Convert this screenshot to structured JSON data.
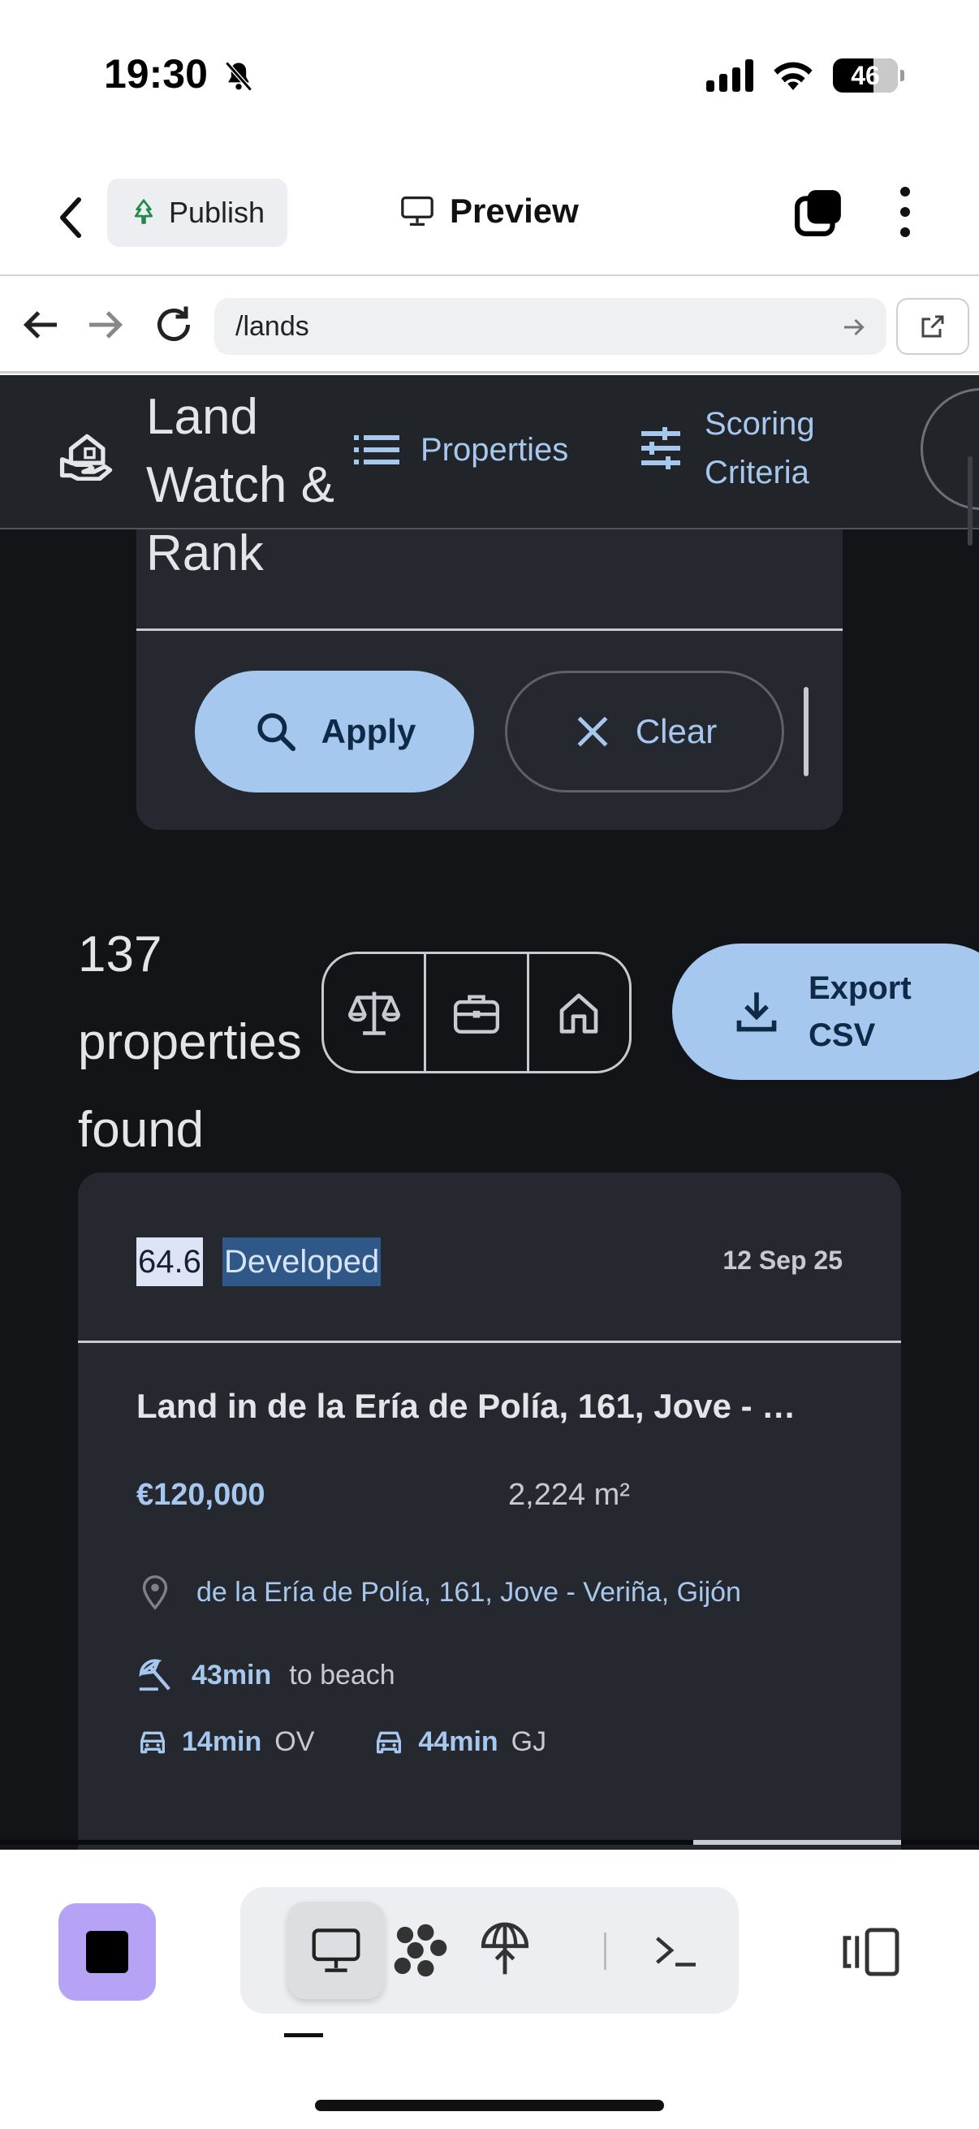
{
  "status_bar": {
    "time": "19:30",
    "battery": "46"
  },
  "app_header": {
    "publish_label": "Publish",
    "preview_label": "Preview"
  },
  "browser": {
    "url": "/lands"
  },
  "topnav": {
    "title": "Land Watch & Rank",
    "links": [
      {
        "label": "Properties",
        "icon": "list-icon"
      },
      {
        "label": "Scoring Criteria",
        "icon": "tune-icon"
      }
    ]
  },
  "filters": {
    "apply_label": "Apply",
    "clear_label": "Clear"
  },
  "results": {
    "count_text": "137 properties found",
    "view_icons": [
      "scale-icon",
      "briefcase-icon",
      "house-icon"
    ],
    "export_label": "Export CSV"
  },
  "property": {
    "score": "64.6",
    "status": "Developed",
    "date": "12 Sep 25",
    "title": "Land in de la Ería de Polía, 161, Jove - …",
    "price": "€120,000",
    "area": "2,224 m²",
    "address": "de la Ería de Polía, 161, Jove - Veriña, Gijón",
    "beach_time": "43min",
    "beach_label": "to beach",
    "drives": [
      {
        "time": "14min",
        "place": "OV"
      },
      {
        "time": "44min",
        "place": "GJ"
      }
    ]
  },
  "colors": {
    "accent": "#a7c8ee",
    "background": "#121418",
    "surface": "#25282e",
    "stop": "#b7a3f5"
  }
}
